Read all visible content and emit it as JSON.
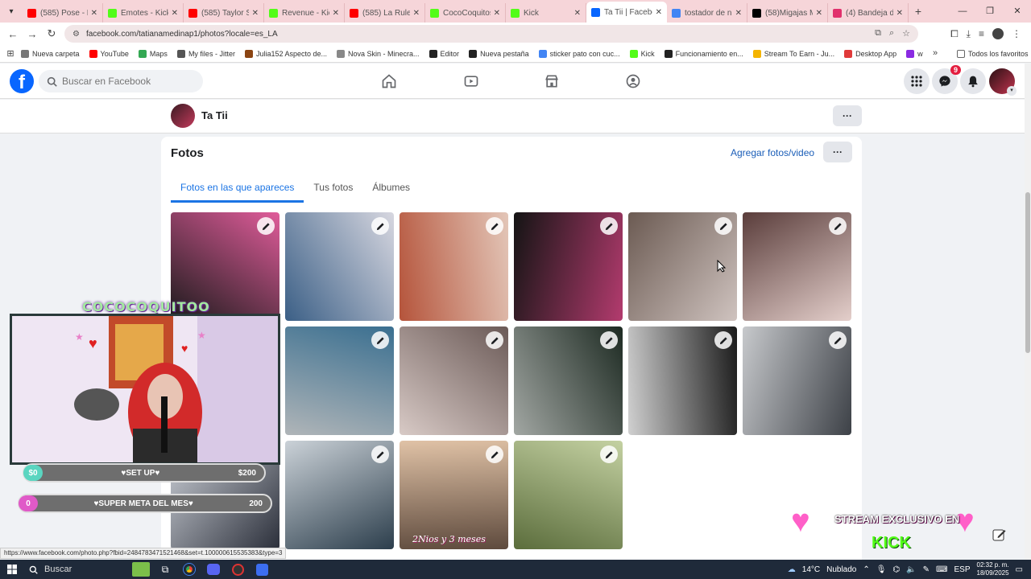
{
  "browser": {
    "tabs": [
      {
        "title": "(585) Pose - Dr",
        "color": "#ff0000",
        "icon": "youtube-icon"
      },
      {
        "title": "Emotes - Kick",
        "color": "#53fc18",
        "icon": "kick-icon"
      },
      {
        "title": "(585) Taylor Sw",
        "color": "#ff0000",
        "icon": "youtube-icon"
      },
      {
        "title": "Revenue - Kick",
        "color": "#53fc18",
        "icon": "kick-icon"
      },
      {
        "title": "(585) La Ruleta",
        "color": "#ff0000",
        "icon": "youtube-icon"
      },
      {
        "title": "CocoCoquitos",
        "color": "#53fc18",
        "icon": "kick-icon"
      },
      {
        "title": "Kick",
        "color": "#53fc18",
        "icon": "kick-icon"
      },
      {
        "title": "Ta Tii | Faceboo",
        "color": "#0866ff",
        "icon": "facebook-icon",
        "active": true
      },
      {
        "title": "tostador de ni",
        "color": "#4285f4",
        "icon": "google-icon"
      },
      {
        "title": "(58)Migajas M",
        "color": "#000000",
        "icon": "tiktok-icon"
      },
      {
        "title": "(4) Bandeja de",
        "color": "#e1306c",
        "icon": "instagram-icon"
      }
    ],
    "url": "facebook.com/tatianamedinap1/photos?locale=es_LA",
    "bookmarks": [
      {
        "label": "Nueva carpeta",
        "color": "#777"
      },
      {
        "label": "YouTube",
        "color": "#ff0000"
      },
      {
        "label": "Maps",
        "color": "#34a853"
      },
      {
        "label": "My files - Jitter",
        "color": "#555"
      },
      {
        "label": "Julia152 Aspecto de...",
        "color": "#8b4513"
      },
      {
        "label": "Nova Skin - Minecra...",
        "color": "#888"
      },
      {
        "label": "Editor",
        "color": "#222"
      },
      {
        "label": "Nueva pestaña",
        "color": "#222"
      },
      {
        "label": "sticker pato con cuc...",
        "color": "#4285f4"
      },
      {
        "label": "Kick",
        "color": "#53fc18"
      },
      {
        "label": "Funcionamiento en...",
        "color": "#222"
      },
      {
        "label": "Stream To Earn - Ju...",
        "color": "#f4b400"
      },
      {
        "label": "Desktop App",
        "color": "#e03a3a"
      },
      {
        "label": "w",
        "color": "#8a2be2"
      }
    ],
    "bookmarks_more": "»",
    "all_favorites": "Todos los favoritos"
  },
  "fb": {
    "search_placeholder": "Buscar en Facebook",
    "messenger_badge": "9",
    "profile_name": "Ta Tii",
    "section_title": "Fotos",
    "add_photos": "Agregar fotos/video",
    "tabs": [
      "Fotos en las que apareces",
      "Tus fotos",
      "Álbumes"
    ],
    "photos": [
      {
        "a": "#1a1a1a",
        "b": "#e05c9a"
      },
      {
        "a": "#3b5f86",
        "b": "#d7d7e0"
      },
      {
        "a": "#b5543b",
        "b": "#e3c6b8"
      },
      {
        "a": "#141414",
        "b": "#b33b6e"
      },
      {
        "a": "#6b5a52",
        "b": "#cfc3bf"
      },
      {
        "a": "#5a3d3b",
        "b": "#e4cfcb"
      },
      {
        "a": "#6d2b3b",
        "b": "#d89aa8"
      },
      {
        "a": "#3a6f90",
        "b": "#b0b5b8"
      },
      {
        "a": "#6b5a57",
        "b": "#d8cac6"
      },
      {
        "a": "#1d2a22",
        "b": "#a2a7a3"
      },
      {
        "a": "#1b1b1b",
        "b": "#d0d0d0"
      },
      {
        "a": "#3d4147",
        "b": "#c7c9cc"
      },
      {
        "a": "#2b2f3a",
        "b": "#cfd3da"
      },
      {
        "a": "#2c3e4c",
        "b": "#cbd2d8"
      },
      {
        "a": "#5e4a3d",
        "b": "#e0c2a6"
      },
      {
        "a": "#5b6d3c",
        "b": "#c4d1a2"
      }
    ],
    "photo_caption": "2Nios y 3 meses"
  },
  "overlay": {
    "title": "COCOCOQUITOO",
    "goal1_left": "$0",
    "goal1_label": "♥SET UP♥",
    "goal1_right": "$200",
    "goal2_left": "0",
    "goal2_label": "♥SUPER META DEL MES♥",
    "goal2_right": "200",
    "promo": "STREAM EXCLUSIVO EN",
    "promo_brand": "KICK"
  },
  "status_url": "https://www.facebook.com/photo.php?fbid=2484783471521468&set=t.100000615535383&type=3",
  "taskbar": {
    "search": "Buscar",
    "weather": "14°C",
    "weather_desc": "Nublado",
    "lang": "ESP",
    "time": "02:32 p. m.",
    "date": "18/09/2025"
  },
  "colors": {
    "fb_blue": "#0866ff",
    "link_blue": "#1b74e4",
    "kick_green": "#53fc18"
  }
}
